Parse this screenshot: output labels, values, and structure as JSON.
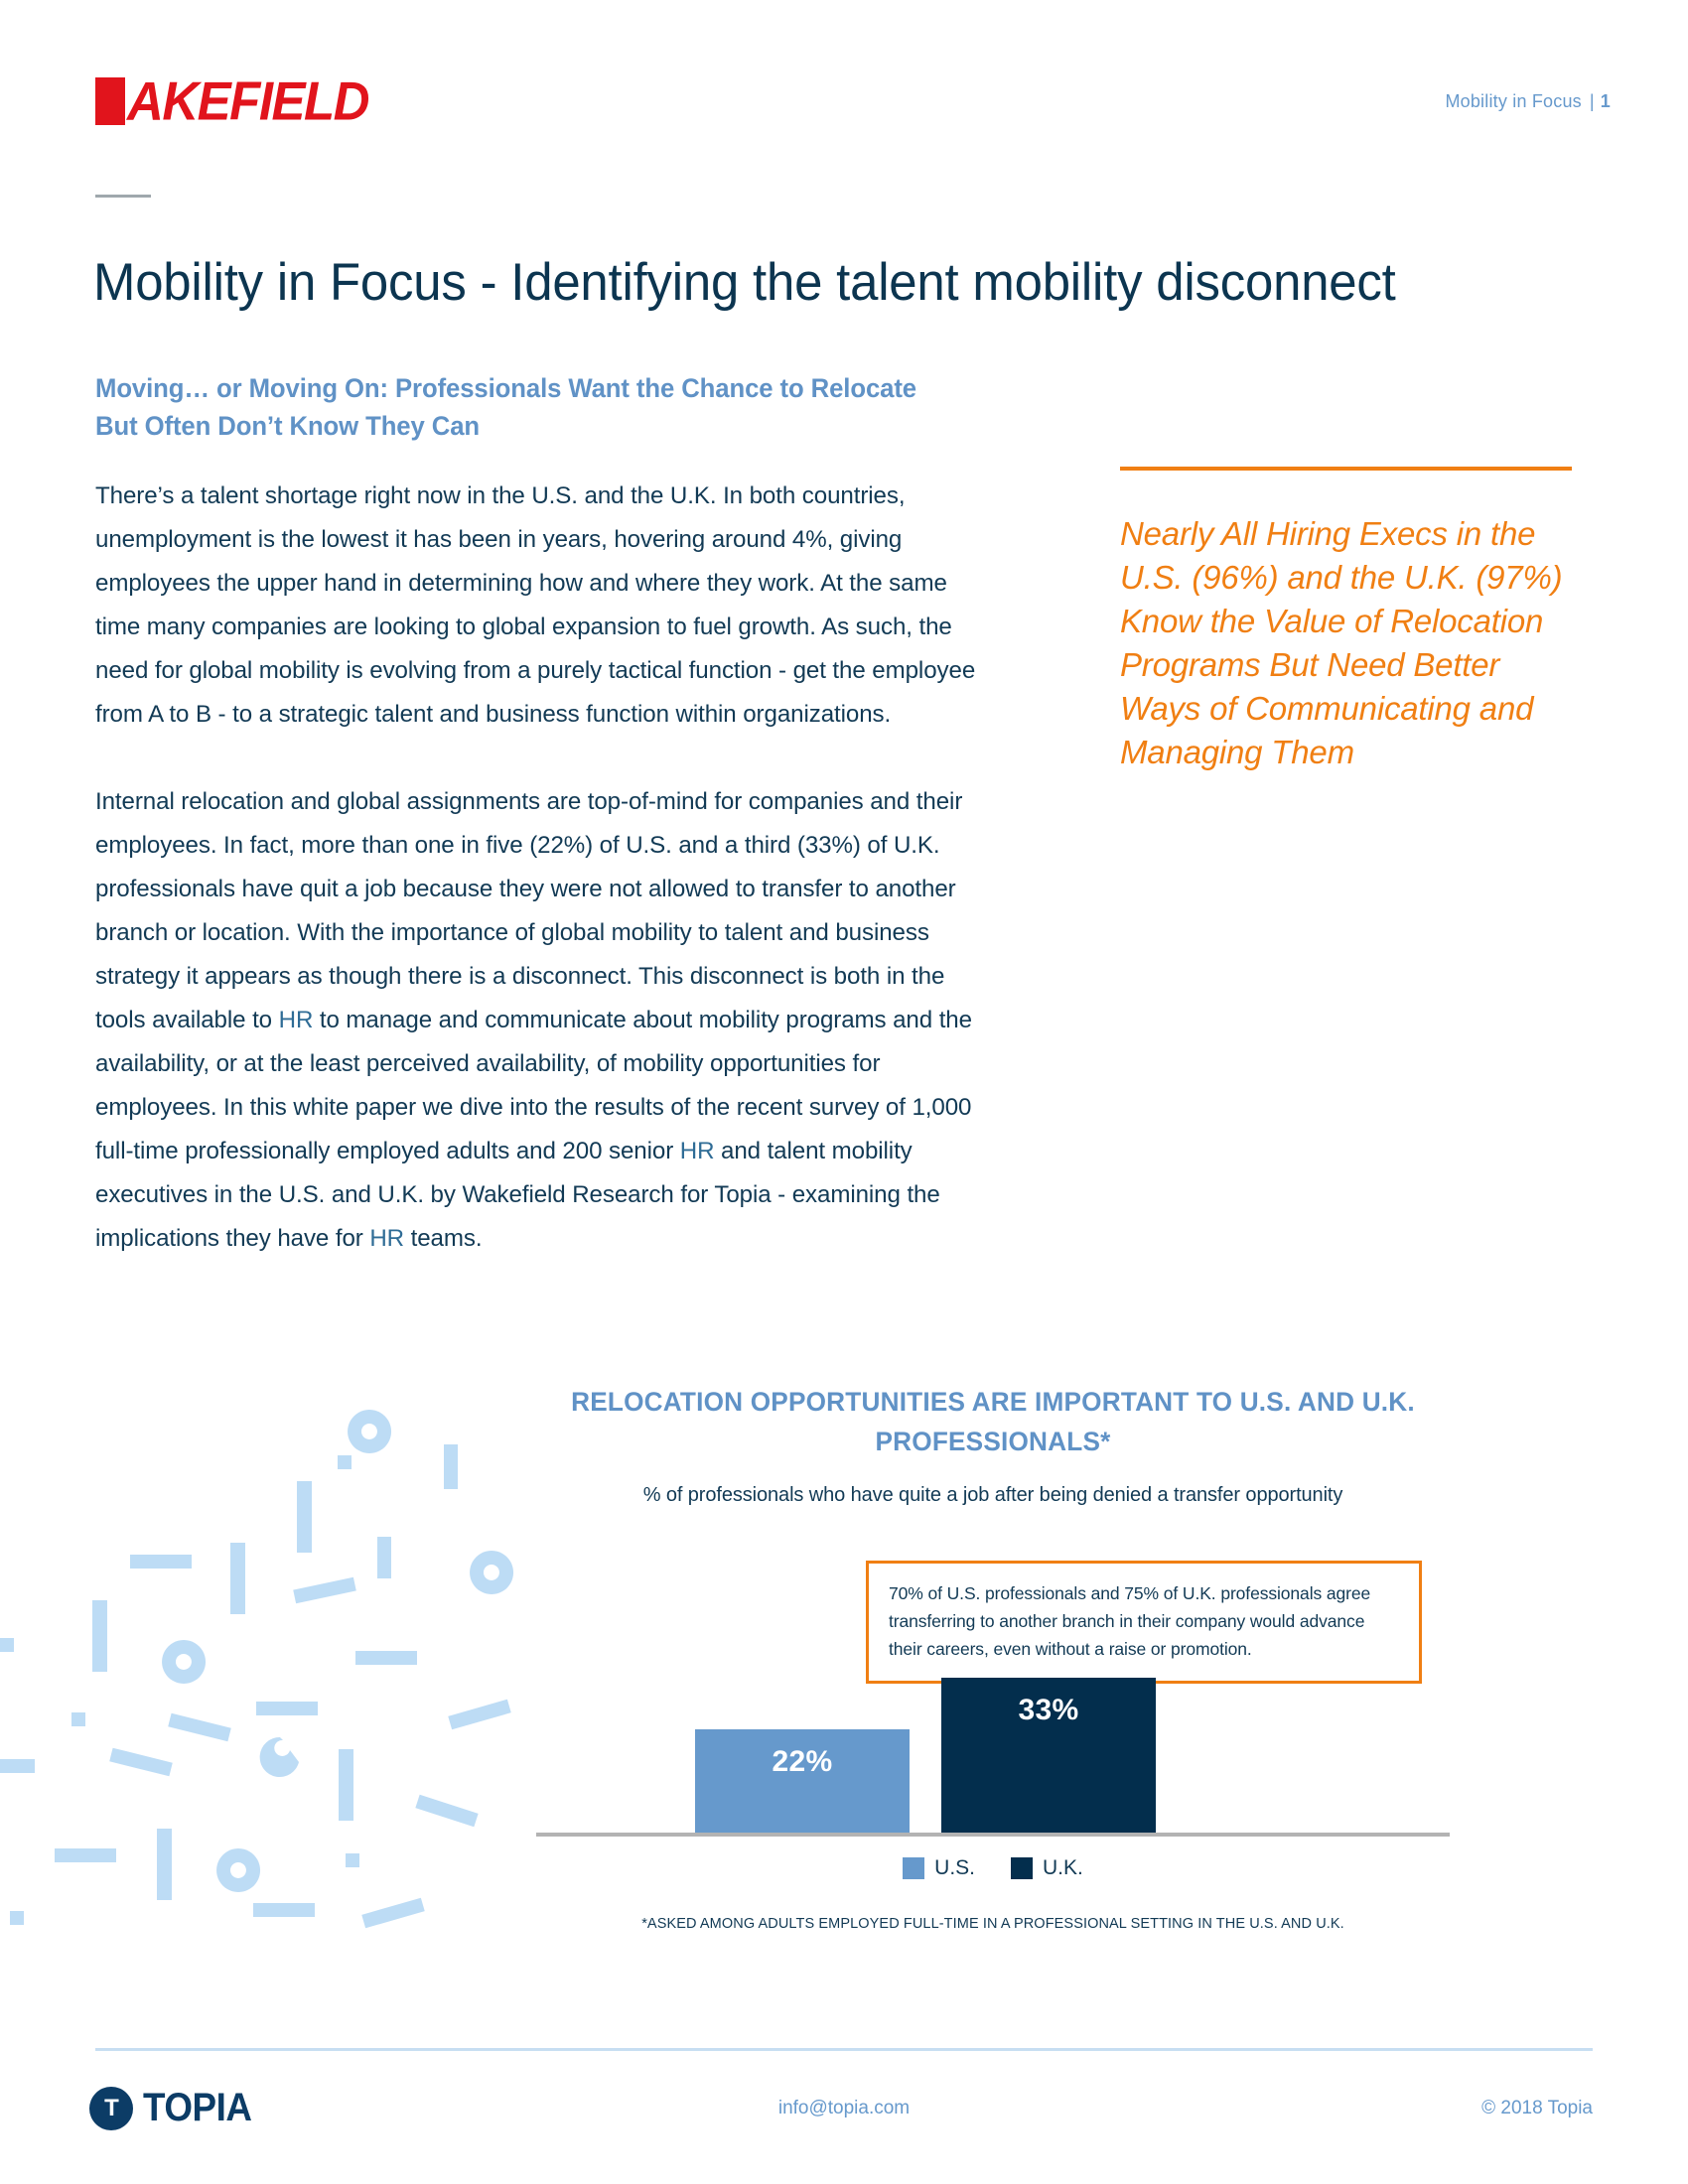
{
  "header": {
    "logo_text": "AKEFIELD",
    "logo_full": "WAKEFIELD",
    "right_label": "Mobility in Focus",
    "separator": "|",
    "page_number": "1"
  },
  "title": "Mobility in Focus - Identifying the talent mobility disconnect",
  "subheading": "Moving… or Moving On: Professionals Want the Chance to Relocate But Often Don’t Know They Can",
  "body": {
    "paragraph_1": "There’s a talent shortage right now in the U.S. and the U.K. In both countries, unemployment is the lowest it has been in years, hovering around 4%, giving employees the upper hand in determining how and where they work. At the same time many companies are looking to global expansion to fuel growth. As such, the need for global mobility is evolving from a purely tactical function - get the employee from A to B - to a strategic talent and business function within organizations.",
    "paragraph_2_part1": "Internal relocation and global assignments are top-of-mind for companies and their employees. In fact, more than one in five (22%) of U.S. and a third (33%) of U.K. professionals have quit a job because they were not allowed to transfer to another branch or location. With the importance of global mobility to talent and business strategy it appears as though there is a disconnect. This disconnect is both in the tools available to ",
    "paragraph_2_hr1": "HR",
    "paragraph_2_part2": " to manage and communicate about mobility programs and the availability, or at the least perceived availability, of mobility opportunities for employees. In this white paper we dive into the results of the recent survey of 1,000 full-time professionally employed adults and 200 senior ",
    "paragraph_2_hr2": "HR",
    "paragraph_2_part3": " and talent mobility executives in the U.S. and U.K. by Wakefield Research for Topia - examining the implications they have for ",
    "paragraph_2_hr3": "HR",
    "paragraph_2_part4": " teams."
  },
  "pullquote": "Nearly All Hiring Execs in the U.S. (96%) and the U.K. (97%) Know the Value of Relocation Programs But Need Better Ways of Communicating and Managing Them",
  "callout": "70% of U.S. professionals and 75% of U.K. professionals agree transferring to another branch in their company would advance their careers, even without a raise or promotion.",
  "chart_data": {
    "type": "bar",
    "title": "RELOCATION OPPORTUNITIES ARE IMPORTANT TO U.S. AND U.K. PROFESSIONALS*",
    "subtitle": "% of professionals who have quite a job after being denied a transfer opportunity",
    "categories": [
      "U.S.",
      "U.K."
    ],
    "values": [
      22,
      33
    ],
    "value_labels": [
      "22%",
      "33%"
    ],
    "series": [
      {
        "name": "U.S.",
        "values": [
          22
        ],
        "color": "#6699CC"
      },
      {
        "name": "U.K.",
        "values": [
          33
        ],
        "color": "#032E4D"
      }
    ],
    "legend": [
      {
        "label": "U.S.",
        "color": "#6699CC"
      },
      {
        "label": "U.K.",
        "color": "#032E4D"
      }
    ],
    "legend_position": "bottom",
    "grid": false,
    "xlabel": "",
    "ylabel": "",
    "ylim": [
      0,
      40
    ],
    "footnote": "*ASKED AMONG ADULTS EMPLOYED FULL-TIME IN A PROFESSIONAL SETTING IN THE U.S. AND U.K."
  },
  "footer": {
    "logo_text": "TOPIA",
    "logo_mark": "T",
    "email": "info@topia.com",
    "copyright": "© 2018 Topia"
  },
  "colors": {
    "brand_red": "#E1141C",
    "navy": "#0C3550",
    "mid_blue": "#6092C6",
    "light_blue": "#6699CC",
    "pale_blue": "#BDDCF5",
    "orange": "#F07F13",
    "dark_navy": "#032E4D"
  }
}
